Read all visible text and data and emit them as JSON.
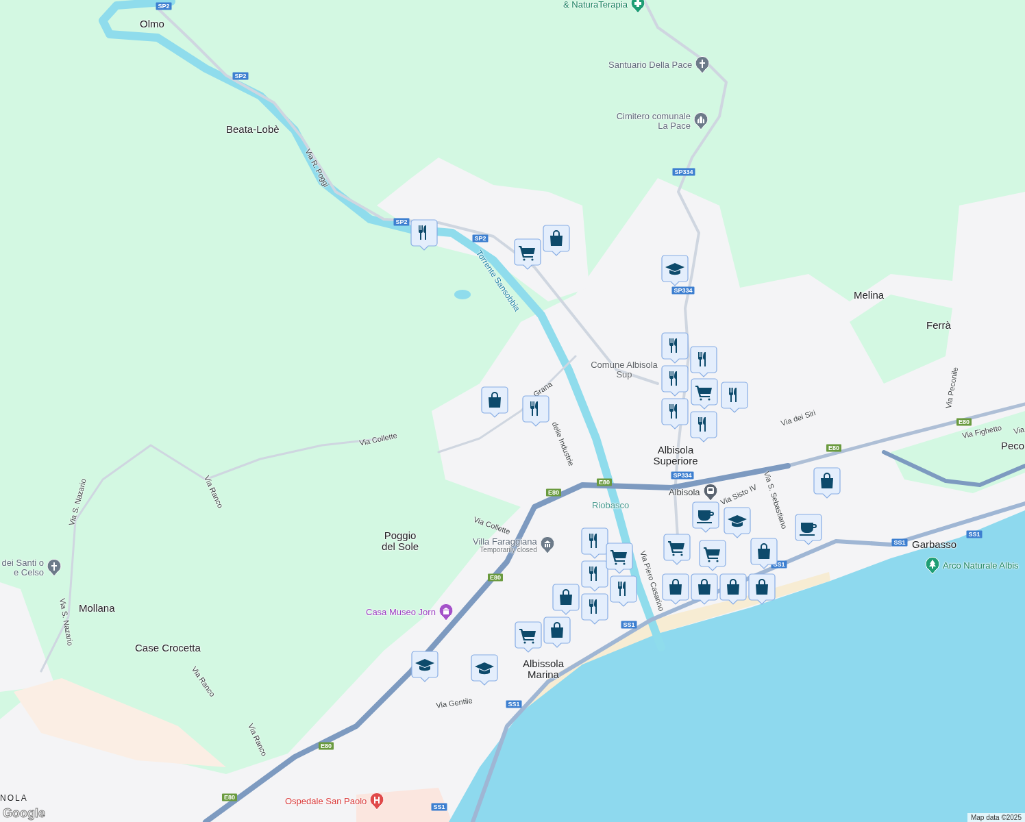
{
  "map": {
    "places": [
      {
        "name": "Olmo",
        "kind": "village"
      },
      {
        "name": "Beata-Lobè",
        "kind": "village"
      },
      {
        "name": "Melina",
        "kind": "village"
      },
      {
        "name": "Ferrà",
        "kind": "village"
      },
      {
        "name": "Peco",
        "kind": "village"
      },
      {
        "name": "Poggio del Sole",
        "kind": "village"
      },
      {
        "name": "Mollana",
        "kind": "village"
      },
      {
        "name": "Case Crocetta",
        "kind": "village"
      },
      {
        "name": "Albisola Superiore",
        "kind": "town"
      },
      {
        "name": "Albissola Marina",
        "kind": "town"
      },
      {
        "name": "Garbasso",
        "kind": "village"
      },
      {
        "name": "NOLA",
        "kind": "city"
      },
      {
        "name": "Comune Albisola Sup",
        "kind": "locality"
      },
      {
        "name": "Riobasco",
        "kind": "district"
      }
    ],
    "pois": [
      {
        "name": "& NaturaTerapia",
        "kind": "health"
      },
      {
        "name": "Santuario Della Pace",
        "kind": "church"
      },
      {
        "name": "Cimitero comunale La Pace",
        "kind": "cemetery"
      },
      {
        "name": "dei Santi o e Celso",
        "kind": "church"
      },
      {
        "name": "Villa Faraggiana",
        "kind": "historic",
        "status": "Temporarily closed"
      },
      {
        "name": "Casa Museo Jorn",
        "kind": "museum"
      },
      {
        "name": "Ospedale San Paolo",
        "kind": "hospital"
      },
      {
        "name": "Arco Naturale Albis",
        "kind": "park"
      },
      {
        "name": "Albisola",
        "kind": "station"
      }
    ],
    "streets": [
      {
        "name": "Via R. Poggi",
        "kind": "road"
      },
      {
        "name": "Torrente Sansobbia",
        "kind": "water"
      },
      {
        "name": "Grana",
        "kind": "road"
      },
      {
        "name": "delle Industrie",
        "kind": "road"
      },
      {
        "name": "Via Collette",
        "kind": "road"
      },
      {
        "name": "Via Collette",
        "kind": "road"
      },
      {
        "name": "Via Ranco",
        "kind": "road"
      },
      {
        "name": "Via Ranco",
        "kind": "road"
      },
      {
        "name": "Via Ranco",
        "kind": "road"
      },
      {
        "name": "Via S. Nazario",
        "kind": "road"
      },
      {
        "name": "Via S. Nazario",
        "kind": "road"
      },
      {
        "name": "Via dei Siri",
        "kind": "road"
      },
      {
        "name": "Via Sisto IV",
        "kind": "road"
      },
      {
        "name": "Via S. Sebastiano",
        "kind": "road"
      },
      {
        "name": "Via Piero Casarino",
        "kind": "road"
      },
      {
        "name": "Via Gentile",
        "kind": "road"
      },
      {
        "name": "Via Peconile",
        "kind": "road"
      },
      {
        "name": "Via Fighetto",
        "kind": "road"
      },
      {
        "name": "Via",
        "kind": "road"
      }
    ],
    "shields": [
      {
        "label": "SP2",
        "kind": "provincial"
      },
      {
        "label": "SP2",
        "kind": "provincial"
      },
      {
        "label": "SP2",
        "kind": "provincial"
      },
      {
        "label": "SP2",
        "kind": "provincial"
      },
      {
        "label": "SP334",
        "kind": "provincial"
      },
      {
        "label": "SP334",
        "kind": "provincial"
      },
      {
        "label": "SP334",
        "kind": "provincial"
      },
      {
        "label": "E80",
        "kind": "european"
      },
      {
        "label": "E80",
        "kind": "european"
      },
      {
        "label": "E80",
        "kind": "european"
      },
      {
        "label": "E80",
        "kind": "european"
      },
      {
        "label": "E80",
        "kind": "european"
      },
      {
        "label": "E80",
        "kind": "european"
      },
      {
        "label": "E80",
        "kind": "european"
      },
      {
        "label": "SS1",
        "kind": "provincial"
      },
      {
        "label": "SS1",
        "kind": "provincial"
      },
      {
        "label": "SS1",
        "kind": "provincial"
      },
      {
        "label": "SS1",
        "kind": "provincial"
      },
      {
        "label": "SS1",
        "kind": "provincial"
      },
      {
        "label": "SS1",
        "kind": "provincial"
      }
    ],
    "markers": [
      {
        "kind": "restaurant"
      },
      {
        "kind": "restaurant"
      },
      {
        "kind": "restaurant"
      },
      {
        "kind": "restaurant"
      },
      {
        "kind": "restaurant"
      },
      {
        "kind": "restaurant"
      },
      {
        "kind": "restaurant"
      },
      {
        "kind": "restaurant"
      },
      {
        "kind": "restaurant"
      },
      {
        "kind": "restaurant"
      },
      {
        "kind": "restaurant"
      },
      {
        "kind": "restaurant"
      },
      {
        "kind": "shop"
      },
      {
        "kind": "shop"
      },
      {
        "kind": "shop"
      },
      {
        "kind": "shop"
      },
      {
        "kind": "shop"
      },
      {
        "kind": "shop"
      },
      {
        "kind": "shop"
      },
      {
        "kind": "shop"
      },
      {
        "kind": "shop"
      },
      {
        "kind": "shop"
      },
      {
        "kind": "grocery"
      },
      {
        "kind": "grocery"
      },
      {
        "kind": "grocery"
      },
      {
        "kind": "grocery"
      },
      {
        "kind": "grocery"
      },
      {
        "kind": "grocery"
      },
      {
        "kind": "school"
      },
      {
        "kind": "school"
      },
      {
        "kind": "school"
      },
      {
        "kind": "school"
      },
      {
        "kind": "cafe"
      },
      {
        "kind": "cafe"
      }
    ],
    "logo": "Google",
    "attribution": "Map data ©2025"
  }
}
